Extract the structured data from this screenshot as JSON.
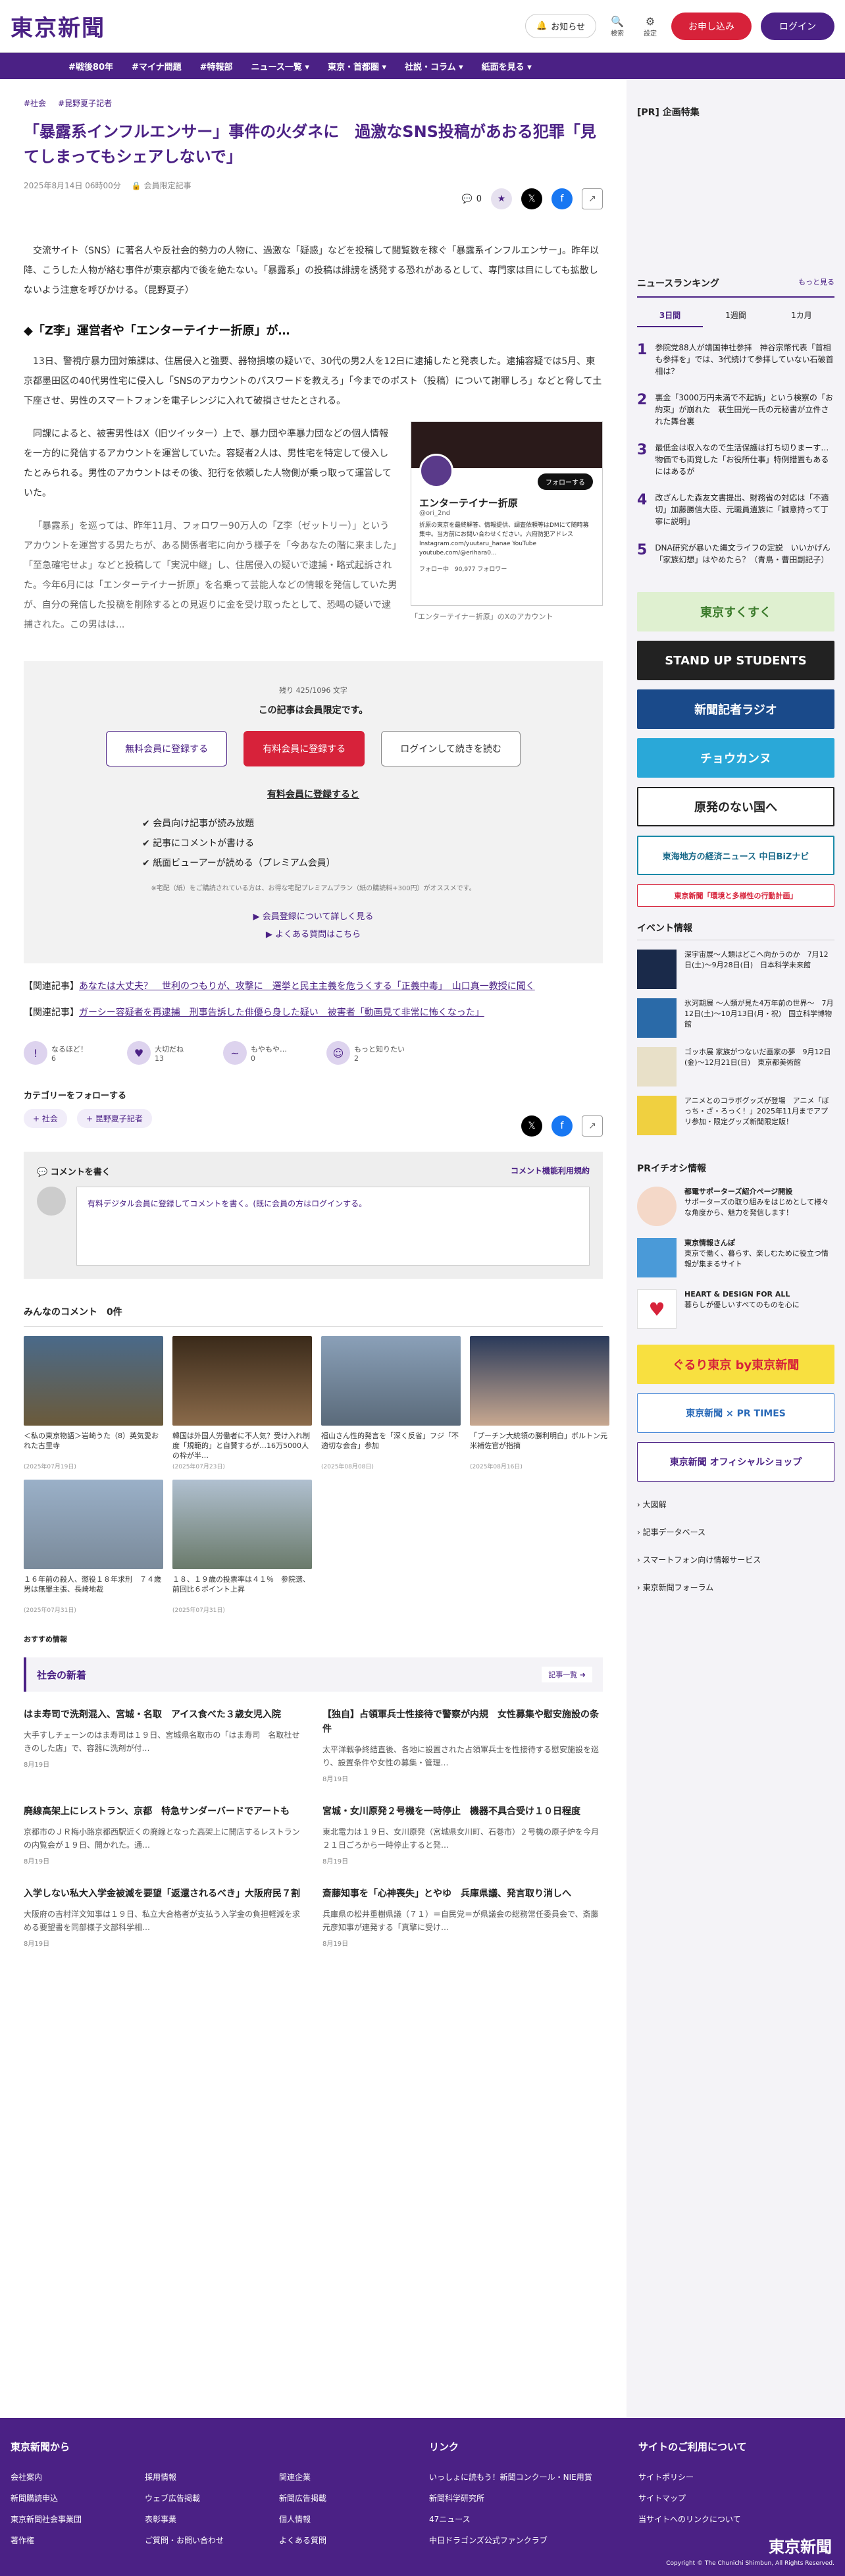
{
  "header": {
    "logo": "東京新聞",
    "notice": "お知らせ",
    "search": "検索",
    "settings": "設定",
    "subscribe": "お申し込み",
    "login": "ログイン"
  },
  "nav": [
    "#戦後80年",
    "#マイナ問題",
    "#特報部",
    "ニュース一覧 ▾",
    "東京・首都圏 ▾",
    "社説・コラム ▾",
    "紙面を見る ▾"
  ],
  "article": {
    "tags": [
      "#社会",
      "#昆野夏子記者"
    ],
    "title": "「暴露系インフルエンサー」事件の火ダネに　過激なSNS投稿があおる犯罪「見てしまってもシェアしないで」",
    "date": "2025年8月14日 06時00分",
    "members": "会員限定記事",
    "comment_count": "0",
    "p1": "交流サイト（SNS）に著名人や反社会的勢力の人物に、過激な「疑惑」などを投稿して閲覧数を稼ぐ「暴露系インフルエンサー」。昨年以降、こうした人物が絡む事件が東京都内で後を絶たない。「暴露系」の投稿は誹謗を誘発する恐れがあるとして、専門家は目にしても拡散しないよう注意を呼びかける。（昆野夏子）",
    "h2": "◆「Z李」運営者や「エンターテイナー折原」が…",
    "p2": "13日、警視庁暴力団対策課は、住居侵入と強要、器物損壊の疑いで、30代の男2人を12日に逮捕したと発表した。逮捕容疑では5月、東京都墨田区の40代男性宅に侵入し「SNSのアカウントのパスワードを教えろ」「今までのポスト（投稿）について謝罪しろ」などと脅して土下座させ、男性のスマートフォンを電子レンジに入れて破損させたとされる。",
    "p3": "同課によると、被害男性はX（旧ツイッター）上で、暴力団や準暴力団などの個人情報を一方的に発信するアカウントを運営していた。容疑者2人は、男性宅を特定して侵入したとみられる。男性のアカウントはその後、犯行を依頼した人物側が乗っ取って運営していた。",
    "p4": "「暴露系」を巡っては、昨年11月、フォロワー90万人の「Z李（ゼットリー）」というアカウントを運営する男たちが、ある関係者宅に向かう様子を「今あなたの階に来ました」「至急確宅せよ」などと投稿して「実況中継」し、住居侵入の疑いで逮捕・略式起訴された。今年6月には「エンターテイナー折原」を名乗って芸能人などの情報を発信していた男が、自分の発信した投稿を削除するとの見返りに金を受け取ったとして、恐喝の疑いで逮捕された。この男はは...",
    "figure": {
      "name": "エンターテイナー折原",
      "handle": "@ori_2nd",
      "bio": "折原の東京を最終解答、情報提供、調査依頼等はDMにて随時募集中。当方前にお問い合わせください。六府防犯アドレス Instagram.com/yuutaru_hanae YouTube youtube.com/@erihara0...",
      "follow": "フォローする",
      "stats": "フォロー中　90,977 フォロワー",
      "caption": "「エンターテイナー折原」のXのアカウント"
    },
    "paywall": {
      "progress": "残り 425/1096 文字",
      "note": "この記事は会員限定です。",
      "free": "無料会員に登録する",
      "paid": "有料会員に登録する",
      "login": "ログインして続きを読む",
      "benefits_title": "有料会員に登録すると",
      "benefits": [
        "会員向け記事が読み放題",
        "記事にコメントが書ける",
        "紙面ビューアーが読める（プレミアム会員）"
      ],
      "footnote": "※宅配（紙）をご購読されている方は、お得な宅配プレミアムプラン（紙の購読料+300円）がオススメです。",
      "more": "会員登録について詳しく見る",
      "faq": "よくある質問はこちら"
    },
    "related": [
      {
        "label": "【関連記事】",
        "text": "あなたは大丈夫？　世利のつもりが、攻撃に　選挙と民主主義を危うくする「正義中毒」　山口真一教授に聞く"
      },
      {
        "label": "【関連記事】",
        "text": "ガーシー容疑者を再逮捕　刑事告訴した俳優ら身した疑い　被害者「動画見て非常に怖くなった」"
      }
    ],
    "reactions": [
      {
        "label": "なるほど！",
        "count": "6"
      },
      {
        "label": "大切だね",
        "count": "13"
      },
      {
        "label": "もやもや…",
        "count": "0"
      },
      {
        "label": "もっと知りたい",
        "count": "2"
      }
    ],
    "follow_title": "カテゴリーをフォローする",
    "follow_tags": [
      "社会",
      "昆野夏子記者"
    ],
    "comment": {
      "title": "コメントを書く",
      "terms": "コメント機能利用規約",
      "prompt": "有料デジタル会員に登録してコメントを書く。(既に会員の方はログインする。"
    },
    "comments_title": "みんなのコメント　0件"
  },
  "photos": [
    {
      "cap": "＜私の東京物語＞岩崎うた（8）英気愛おれた古里寺",
      "date": "(2025年07月19日)"
    },
    {
      "cap": "韓国は外国人労働者に不人気？受け入れ制度「規範的」と自賛するが…16万5000人の枠が半…",
      "date": "(2025年07月23日)"
    },
    {
      "cap": "福山さん性的発言を「深く反省」フジ「不適切な会合」参加",
      "date": "(2025年08月08日)"
    },
    {
      "cap": "「プーチン大統領の勝利明白」ボルトン元米補佐官が指摘",
      "date": "(2025年08月16日)"
    },
    {
      "cap": "１６年前の殺人、懲役１８年求刑　７４歳男は無罪主張、長崎地裁",
      "date": "(2025年07月31日)"
    },
    {
      "cap": "１８、１９歳の投票率は４１％　参院選、前回比６ポイント上昇",
      "date": "(2025年07月31日)"
    }
  ],
  "recommend": "おすすめ情報",
  "society": {
    "title": "社会の新着",
    "more": "記事一覧",
    "items": [
      {
        "t": "はま寿司で洗剤混入、宮城・名取　アイス食べた３歳女児入院",
        "d": "大手すしチェーンのはま寿司は１９日、宮城県名取市の「はま寿司　名取杜せきのした店」で、容器に洗剤が付…",
        "dt": "8月19日"
      },
      {
        "t": "【独自】占領軍兵士性接待で警察が内規　女性募集や慰安施設の条件",
        "d": "太平洋戦争終結直後、各地に設置された占領軍兵士を性接待する慰安施設を巡り、設置条件や女性の募集・管理…",
        "dt": "8月19日"
      },
      {
        "t": "廃線高架上にレストラン、京都　特急サンダーバードでアートも",
        "d": "京都市のＪＲ梅小路京都西駅近くの廃線となった高架上に開店するレストランの内覧会が１９日、開かれた。通…",
        "dt": "8月19日"
      },
      {
        "t": "宮城・女川原発２号機を一時停止　機器不具合受け１０日程度",
        "d": "東北電力は１９日、女川原発（宮城県女川町、石巻市）２号機の原子炉を今月２１日ごろから一時停止すると発…",
        "dt": "8月19日"
      },
      {
        "t": "入学しない私大入学金被減を要望「返還されるべき」大阪府民７割",
        "d": "大阪府の吉村洋文知事は１９日、私立大合格者が支払う入学金の負担軽減を求める要望書を同部様子文部科学相…",
        "dt": "8月19日"
      },
      {
        "t": "斎藤知事を「心神喪失」とやゆ　兵庫県議、発言取り消しへ",
        "d": "兵庫県の松井重樹県議（７１）＝自民党＝が県議会の総務常任委員会で、斎藤元彦知事が連発する「真擎に受け…",
        "dt": "8月19日"
      }
    ]
  },
  "side": {
    "pr": "[PR] 企画特集",
    "ranking_title": "ニュースランキング",
    "ranking_more": "もっと見る",
    "tabs": [
      "3日間",
      "1週間",
      "1カ月"
    ],
    "ranking": [
      {
        "n": "1",
        "t": "参院党88人が靖国神社参拝　神谷宗幣代表「首相も参拝を」では、3代続けて参拝していない石破首相は？"
      },
      {
        "n": "2",
        "t": "裏金「3000万円未満で不起訴」という検察の「お約束」が崩れた　萩生田光一氏の元秘書が立件された舞台裏"
      },
      {
        "n": "3",
        "t": "最低金は収入なので生活保護は打ち切りまーす…物価でも両覚した「お役所仕事」特例措置もあるにはあるが"
      },
      {
        "n": "4",
        "t": "改ざんした森友文書提出、財務省の対応は「不適切」加藤勝信大臣、元職員遺族に「誠意持って丁寧に説明」"
      },
      {
        "n": "5",
        "t": "DNA研究が暴いた縄文ライフの定説　いいかげん「家族幻想」はやめたら？（青鳥・曹田副記子）"
      }
    ],
    "banners": [
      "東京すくすく",
      "STAND UP STUDENTS",
      "新聞記者ラジオ",
      "チョウカンヌ",
      "原発のない国へ",
      "東海地方の経済ニュース 中日BiZナビ",
      "東京新聞「環境と多様性の行動計画」"
    ],
    "events_title": "イベント情報",
    "events": [
      {
        "t": "深宇宙展〜人類はどこへ向かうのか　7月12日(土)〜9月28日(日)　日本科学未来館"
      },
      {
        "t": "氷河期展 〜人類が見た4万年前の世界〜　7月12日(土)〜10月13日(月・祝)　国立科学博物館"
      },
      {
        "t": "ゴッホ展 家族がつないだ画家の夢　9月12日(金)〜12月21日(日)　東京都美術館"
      },
      {
        "t": "アニメとのコラボグッズが登場　アニメ「ぼっち・ざ・ろっく！」2025年11月までアプリ参加・限定グッズ新聞限定販！"
      }
    ],
    "pr_title": "PRイチオシ情報",
    "pr_items": [
      {
        "t": "都電サポーターズ紹介ページ開設",
        "d": "サポーターズの取り組みをはじめとして様々な角度から、魅力を発信します！"
      },
      {
        "t": "東京情報さんぽ",
        "d": "東京で働く、暮らす、楽しむために役立つ情報が集まるサイト"
      },
      {
        "t": "HEART & DESIGN FOR ALL",
        "d": "暮らしが優しいすべてのものを心に"
      }
    ],
    "banners2": [
      "ぐるり東京 by東京新聞",
      "東京新聞 × PR TIMES",
      "東京新聞 オフィシャルショップ"
    ],
    "links": [
      "大図解",
      "記事データベース",
      "スマートフォン向け情報サービス",
      "東京新聞フォーラム"
    ]
  },
  "footer": {
    "col1_title": "東京新聞から",
    "col1": [
      "会社案内",
      "新聞購読申込",
      "東京新聞社会事業団",
      "著作権"
    ],
    "col1b": [
      "採用情報",
      "ウェブ広告掲載",
      "表彰事業",
      "ご質問・お問い合わせ"
    ],
    "col1c": [
      "関連企業",
      "新聞広告掲載",
      "個人情報",
      "よくある質問"
    ],
    "col2_title": "リンク",
    "col2": [
      "いっしょに読もう！新聞コンクール・NIE用賞",
      "新聞科学研究所",
      "47ニュース",
      "中日ドラゴンズ公式ファンクラブ"
    ],
    "col3_title": "サイトのご利用について",
    "col3": [
      "サイトポリシー",
      "サイトマップ",
      "当サイトへのリンクについて"
    ],
    "logo": "東京新聞",
    "copyright": "Copyright © The Chunichi Shimbun, All Rights Reserved."
  }
}
